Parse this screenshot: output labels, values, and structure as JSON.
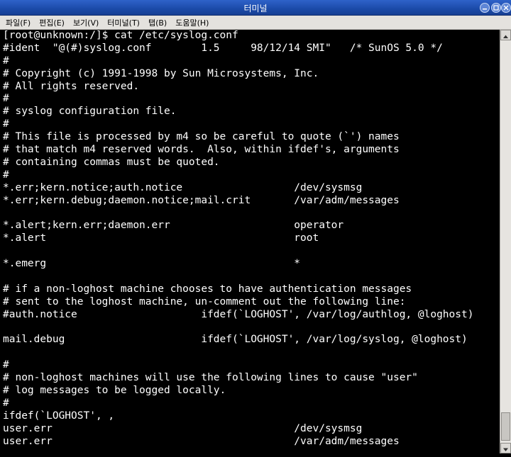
{
  "window": {
    "title": "터미널"
  },
  "menu": {
    "items": [
      {
        "label": "파일(F)"
      },
      {
        "label": "편집(E)"
      },
      {
        "label": "보기(V)"
      },
      {
        "label": "터미널(T)"
      },
      {
        "label": "탭(B)"
      },
      {
        "label": "도움말(H)"
      }
    ]
  },
  "terminal": {
    "lines": [
      "[root@unknown:/]$ cat /etc/syslog.conf",
      "#ident  \"@(#)syslog.conf        1.5     98/12/14 SMI\"   /* SunOS 5.0 */",
      "#",
      "# Copyright (c) 1991-1998 by Sun Microsystems, Inc.",
      "# All rights reserved.",
      "#",
      "# syslog configuration file.",
      "#",
      "# This file is processed by m4 so be careful to quote (`') names",
      "# that match m4 reserved words.  Also, within ifdef's, arguments",
      "# containing commas must be quoted.",
      "#",
      "*.err;kern.notice;auth.notice                  /dev/sysmsg",
      "*.err;kern.debug;daemon.notice;mail.crit       /var/adm/messages",
      "",
      "*.alert;kern.err;daemon.err                    operator",
      "*.alert                                        root",
      "",
      "*.emerg                                        *",
      "",
      "# if a non-loghost machine chooses to have authentication messages",
      "# sent to the loghost machine, un-comment out the following line:",
      "#auth.notice                    ifdef(`LOGHOST', /var/log/authlog, @loghost)",
      "",
      "mail.debug                      ifdef(`LOGHOST', /var/log/syslog, @loghost)",
      "",
      "#",
      "# non-loghost machines will use the following lines to cause \"user\"",
      "# log messages to be logged locally.",
      "#",
      "ifdef(`LOGHOST', ,",
      "user.err                                       /dev/sysmsg",
      "user.err                                       /var/adm/messages"
    ]
  }
}
